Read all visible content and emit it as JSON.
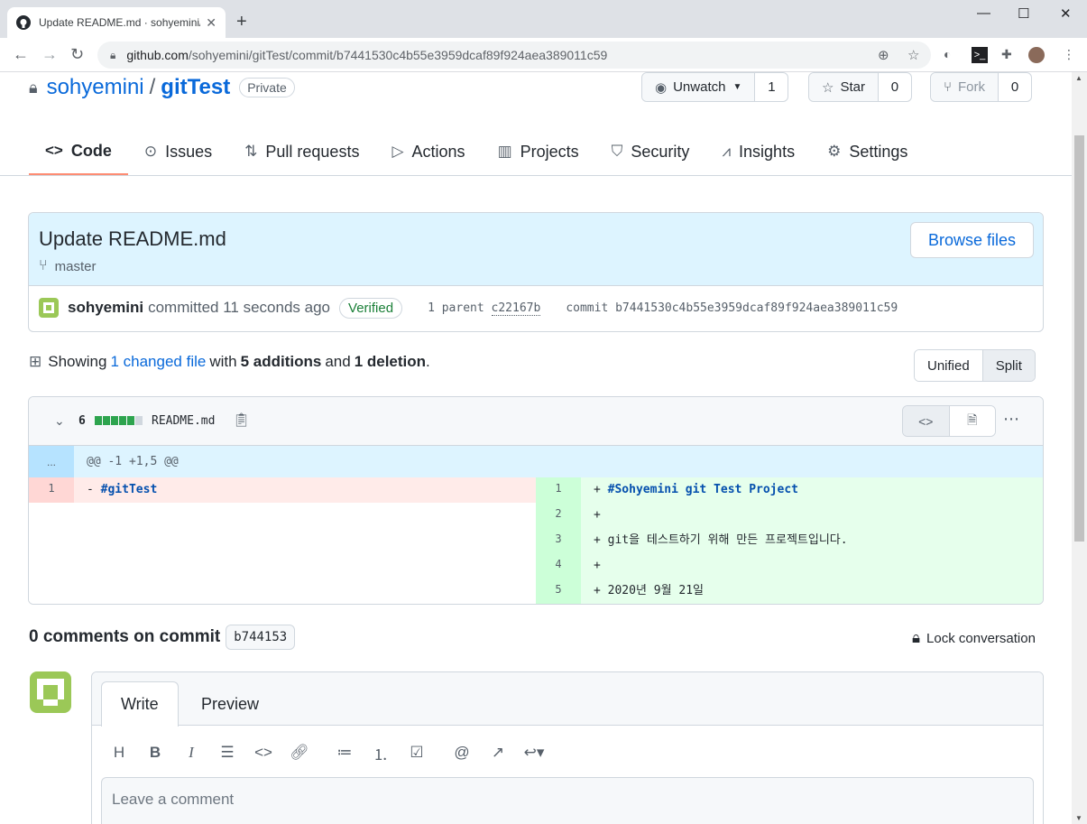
{
  "browser": {
    "tab_title": "Update README.md · sohyemini/gitTest",
    "url_host": "github.com",
    "url_path": "/sohyemini/gitTest/commit/b7441530c4b55e3959dcaf89f924aea389011c59"
  },
  "repo": {
    "owner": "sohyemini",
    "separator": "/",
    "name": "gitTest",
    "visibility": "Private",
    "watch_label": "Unwatch",
    "watch_count": "1",
    "star_label": "Star",
    "star_count": "0",
    "fork_label": "Fork",
    "fork_count": "0"
  },
  "nav": {
    "items": [
      {
        "label": "Code",
        "icon": "code-icon"
      },
      {
        "label": "Issues",
        "icon": "issue-icon"
      },
      {
        "label": "Pull requests",
        "icon": "pull-request-icon"
      },
      {
        "label": "Actions",
        "icon": "play-icon"
      },
      {
        "label": "Projects",
        "icon": "project-icon"
      },
      {
        "label": "Security",
        "icon": "shield-icon"
      },
      {
        "label": "Insights",
        "icon": "graph-icon"
      },
      {
        "label": "Settings",
        "icon": "gear-icon"
      }
    ]
  },
  "commit": {
    "title": "Update README.md",
    "branch": "master",
    "browse_label": "Browse files",
    "author": "sohyemini",
    "action": "committed 11 seconds ago",
    "verified": "Verified",
    "parent_label": "1 parent",
    "parent_sha": "c22167b",
    "commit_label": "commit",
    "sha": "b7441530c4b55e3959dcaf89f924aea389011c59"
  },
  "summary": {
    "showing": "Showing",
    "changed": "1 changed file",
    "with": "with",
    "additions": "5 additions",
    "and": "and",
    "deletions": "1 deletion",
    "period": ".",
    "unified": "Unified",
    "split": "Split"
  },
  "diff": {
    "count": "6",
    "filename": "README.md",
    "hunk_gutter": "...",
    "hunk": "@@ -1 +1,5 @@",
    "left": [
      {
        "num": "1",
        "prefix": "- ",
        "code": "#gitTest"
      }
    ],
    "right": [
      {
        "num": "1",
        "prefix": "+ ",
        "code": "#Sohyemini git Test Project"
      },
      {
        "num": "2",
        "prefix": "+",
        "code": ""
      },
      {
        "num": "3",
        "prefix": "+ ",
        "code": "git을 테스트하기 위해 만든 프로젝트입니다."
      },
      {
        "num": "4",
        "prefix": "+",
        "code": ""
      },
      {
        "num": "5",
        "prefix": "+ ",
        "code": "2020년 9월 21일"
      }
    ],
    "colors": {
      "add_bg": "#e6ffec",
      "add_num": "#ccffd8",
      "del_bg": "#ffebe9",
      "del_num": "#ffd7d5",
      "bar_green": "#2da44e",
      "bar_grey": "#d0d7de"
    }
  },
  "comments": {
    "heading": "0 comments on commit",
    "sha": "b744153",
    "lock_label": "Lock conversation",
    "write_tab": "Write",
    "preview_tab": "Preview",
    "placeholder": "Leave a comment"
  }
}
